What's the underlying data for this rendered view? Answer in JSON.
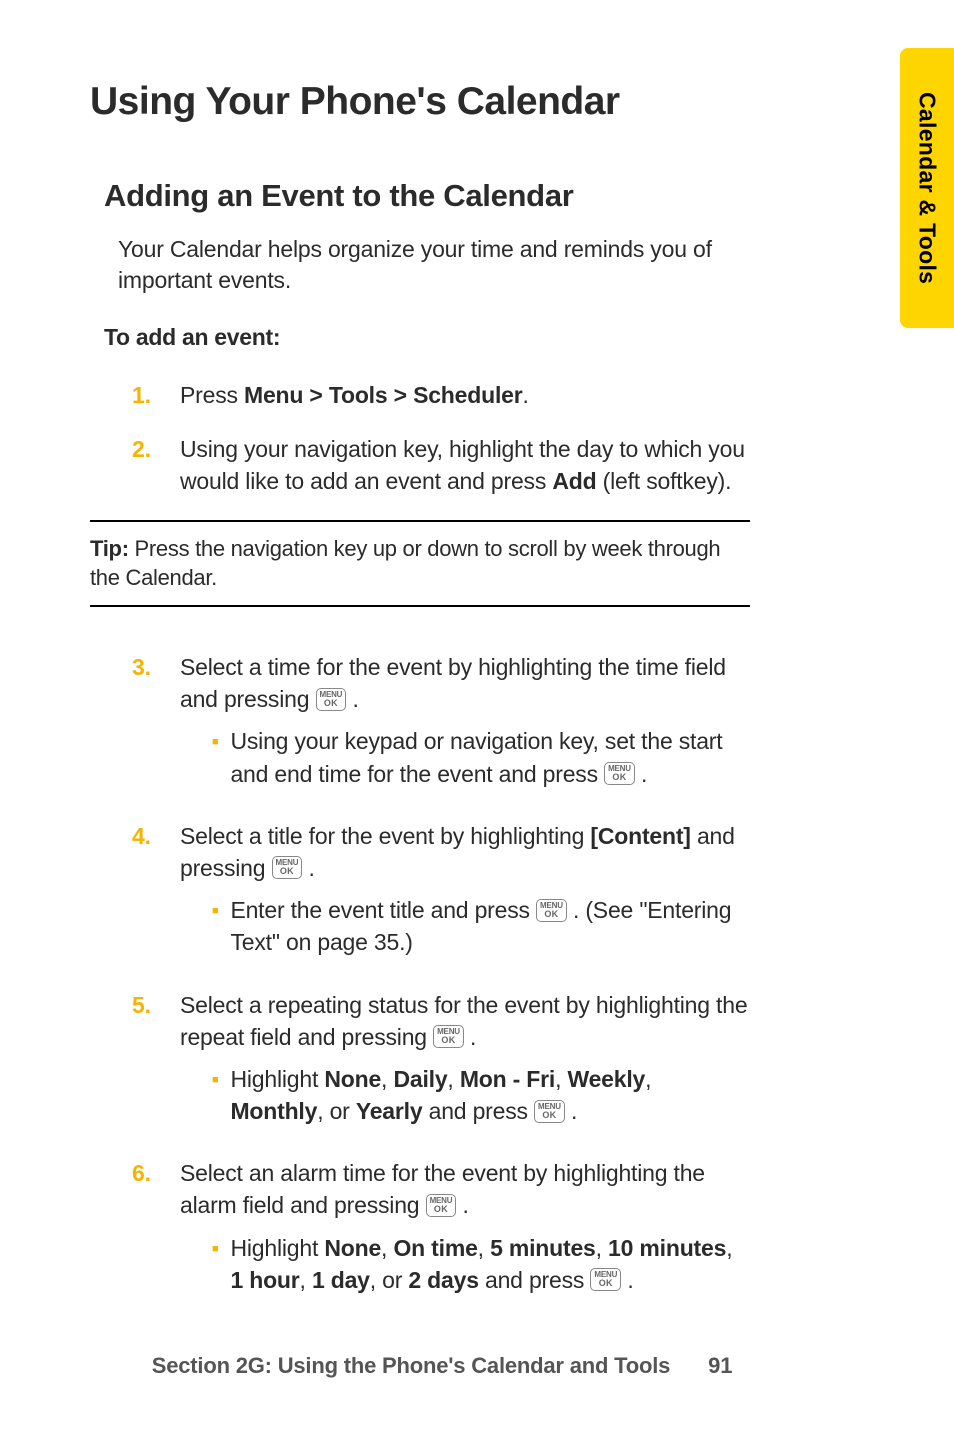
{
  "sideTab": "Calendar & Tools",
  "title": "Using Your Phone's Calendar",
  "section": {
    "heading": "Adding an Event to the Calendar",
    "intro": "Your Calendar helps organize your time and reminds you of important events.",
    "subhead": "To add an event:"
  },
  "steps1": [
    {
      "n": "1.",
      "pre": "Press ",
      "bold": "Menu > Tools > Scheduler",
      "post": "."
    },
    {
      "n": "2.",
      "pre": "Using your navigation key, highlight the day to which you would like to add an event and press ",
      "bold": "Add",
      "post": " (left softkey)."
    }
  ],
  "tip": {
    "label": "Tip:",
    "text": " Press the navigation key up or down to scroll by week through the Calendar."
  },
  "steps2": {
    "s3": {
      "n": "3.",
      "text_a": "Select a time for the event by highlighting the time field and pressing ",
      "text_b": " .",
      "bullet_a": "Using your keypad or navigation key, set the start and end time for the event and press ",
      "bullet_b": " ."
    },
    "s4": {
      "n": "4.",
      "text_a": "Select a title for the event by highlighting ",
      "bold": "[Content]",
      "text_b": " and pressing ",
      "text_c": " .",
      "bullet_a": "Enter the event title and press ",
      "bullet_b": " . (See \"Entering Text\" on page 35.)"
    },
    "s5": {
      "n": "5.",
      "text_a": "Select a repeating status for the event by highlighting the repeat field and pressing ",
      "text_b": " .",
      "bullet_pre": "Highlight ",
      "opts": {
        "o1": "None",
        "o2": "Daily",
        "o3": "Mon - Fri",
        "o4": "Weekly",
        "o5": "Monthly",
        "o6": "Yearly"
      },
      "bullet_mid": ", or ",
      "bullet_post": " and press ",
      "bullet_end": " ."
    },
    "s6": {
      "n": "6.",
      "text_a": "Select an alarm time for the event by highlighting the alarm field and pressing ",
      "text_b": " .",
      "bullet_pre": "Highlight ",
      "opts": {
        "o1": "None",
        "o2": "On time",
        "o3": "5 minutes",
        "o4": "10 minutes",
        "o5": "1 hour",
        "o6": "1 day",
        "o7": "2 days"
      },
      "bullet_mid": ", or ",
      "bullet_post": " and press ",
      "bullet_end": " ."
    }
  },
  "icon": {
    "line1": "MENU",
    "line2": "OK"
  },
  "footer": {
    "section": "Section 2G: Using the Phone's Calendar and Tools",
    "page": "91"
  }
}
